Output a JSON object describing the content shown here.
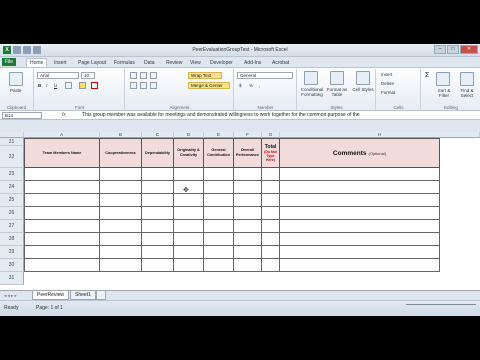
{
  "window": {
    "title": "PeerEvaluationGroupTest - Microsoft Excel",
    "logo": "X"
  },
  "tabs": [
    "File",
    "Home",
    "Insert",
    "Page Layout",
    "Formulas",
    "Data",
    "Review",
    "View",
    "Developer",
    "Add-Ins",
    "Acrobat"
  ],
  "ribbon": {
    "clipboard": {
      "label": "Clipboard",
      "paste": "Paste"
    },
    "font": {
      "label": "Font",
      "name": "Arial",
      "size": "10",
      "bold": "B",
      "italic": "I",
      "underline": "U"
    },
    "alignment": {
      "label": "Alignment",
      "wrap_text": "Wrap Text",
      "merge_center": "Merge & Center"
    },
    "number": {
      "label": "Number",
      "format": "General",
      "currency": "$",
      "percent": "%",
      "comma": ","
    },
    "styles": {
      "label": "Styles",
      "conditional": "Conditional Formatting",
      "format_table": "Format as Table",
      "cell_styles": "Cell Styles"
    },
    "cells": {
      "label": "Cells",
      "insert": "Insert",
      "delete": "Delete",
      "format": "Format"
    },
    "editing": {
      "label": "Editing",
      "sigma": "Σ",
      "sort": "Sort & Filter",
      "find": "Find & Select"
    }
  },
  "formula_bar": {
    "name_box": "B14",
    "fx": "fx",
    "content": "This group member was available for meetings and demonstrated willingness to work together for the common purpose of the"
  },
  "columns": [
    "A",
    "B",
    "C",
    "D",
    "E",
    "F",
    "G",
    "H"
  ],
  "rows": [
    "21",
    "22",
    "23",
    "24",
    "25",
    "26",
    "27",
    "28",
    "29",
    "30",
    "31"
  ],
  "headers": {
    "name": "Team Members Name",
    "coop": "Cooperativeness",
    "dep": "Dependability",
    "orig": "Originality & Creativity",
    "gen": "General Contribution",
    "overall": "Overall Performance",
    "total": "Total",
    "total_note": "(Do Not Type Here)",
    "comments": "Comments",
    "comments_note": "(Optional)"
  },
  "sheets": [
    "PeerReview",
    "Sheet1"
  ],
  "status": {
    "ready": "Ready",
    "page": "Page: 1 of 1"
  }
}
